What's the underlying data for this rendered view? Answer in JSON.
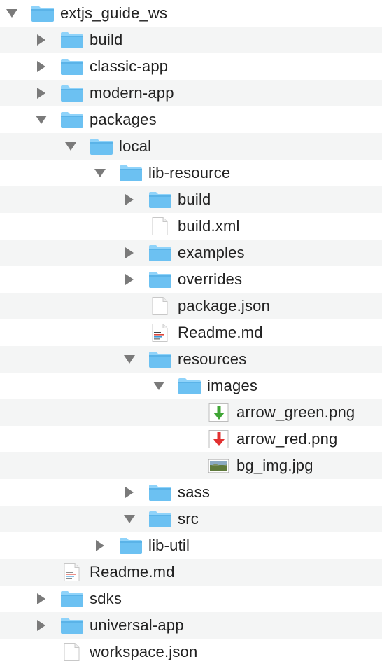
{
  "colors": {
    "stripe": "#f4f5f5",
    "folder_front": "#6cc1f2",
    "folder_back": "#8fd3fa",
    "disclosure": "#7a7a7a",
    "text": "#222222"
  },
  "rows": [
    {
      "label": "extjs_guide_ws",
      "depth": 0,
      "kind": "folder",
      "toggle": "expanded"
    },
    {
      "label": "build",
      "depth": 1,
      "kind": "folder",
      "toggle": "collapsed"
    },
    {
      "label": "classic-app",
      "depth": 1,
      "kind": "folder",
      "toggle": "collapsed"
    },
    {
      "label": "modern-app",
      "depth": 1,
      "kind": "folder",
      "toggle": "collapsed"
    },
    {
      "label": "packages",
      "depth": 1,
      "kind": "folder",
      "toggle": "expanded"
    },
    {
      "label": "local",
      "depth": 2,
      "kind": "folder",
      "toggle": "expanded"
    },
    {
      "label": "lib-resource",
      "depth": 3,
      "kind": "folder",
      "toggle": "expanded"
    },
    {
      "label": "build",
      "depth": 4,
      "kind": "folder",
      "toggle": "collapsed"
    },
    {
      "label": "build.xml",
      "depth": 4,
      "kind": "file",
      "toggle": "none"
    },
    {
      "label": "examples",
      "depth": 4,
      "kind": "folder",
      "toggle": "collapsed"
    },
    {
      "label": "overrides",
      "depth": 4,
      "kind": "folder",
      "toggle": "collapsed"
    },
    {
      "label": "package.json",
      "depth": 4,
      "kind": "file",
      "toggle": "none"
    },
    {
      "label": "Readme.md",
      "depth": 4,
      "kind": "text-file",
      "toggle": "none"
    },
    {
      "label": "resources",
      "depth": 4,
      "kind": "folder",
      "toggle": "expanded"
    },
    {
      "label": "images",
      "depth": 5,
      "kind": "folder",
      "toggle": "expanded"
    },
    {
      "label": "arrow_green.png",
      "depth": 6,
      "kind": "image-green-arrow",
      "toggle": "none"
    },
    {
      "label": "arrow_red.png",
      "depth": 6,
      "kind": "image-red-arrow",
      "toggle": "none"
    },
    {
      "label": "bg_img.jpg",
      "depth": 6,
      "kind": "image-photo",
      "toggle": "none"
    },
    {
      "label": "sass",
      "depth": 4,
      "kind": "folder",
      "toggle": "collapsed"
    },
    {
      "label": "src",
      "depth": 4,
      "kind": "folder",
      "toggle": "expanded"
    },
    {
      "label": "lib-util",
      "depth": 3,
      "kind": "folder",
      "toggle": "collapsed"
    },
    {
      "label": "Readme.md",
      "depth": 1,
      "kind": "text-file",
      "toggle": "none"
    },
    {
      "label": "sdks",
      "depth": 1,
      "kind": "folder",
      "toggle": "collapsed"
    },
    {
      "label": "universal-app",
      "depth": 1,
      "kind": "folder",
      "toggle": "collapsed"
    },
    {
      "label": "workspace.json",
      "depth": 1,
      "kind": "file",
      "toggle": "none"
    }
  ]
}
